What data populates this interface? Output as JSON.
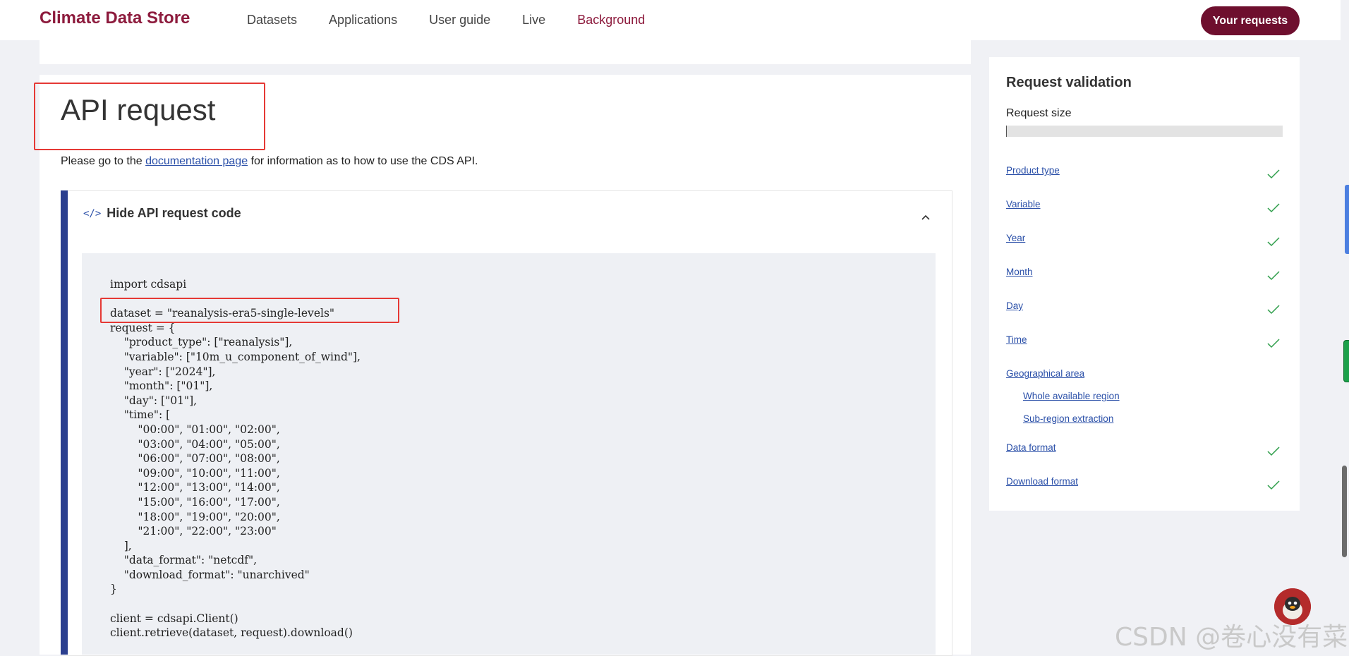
{
  "header": {
    "brand": "Climate Data Store",
    "nav": [
      "Datasets",
      "Applications",
      "User guide",
      "Live",
      "Background"
    ],
    "active_nav": "Background",
    "your_requests": "Your requests"
  },
  "main": {
    "title": "API request",
    "intro_before": "Please go to the ",
    "intro_link": "documentation page",
    "intro_after": " for information as to how to use the CDS API.",
    "toggle_icon": "</>",
    "toggle_label": "Hide API request code",
    "code": "import cdsapi\n\ndataset = \"reanalysis-era5-single-levels\"\nrequest = {\n    \"product_type\": [\"reanalysis\"],\n    \"variable\": [\"10m_u_component_of_wind\"],\n    \"year\": [\"2024\"],\n    \"month\": [\"01\"],\n    \"day\": [\"01\"],\n    \"time\": [\n        \"00:00\", \"01:00\", \"02:00\",\n        \"03:00\", \"04:00\", \"05:00\",\n        \"06:00\", \"07:00\", \"08:00\",\n        \"09:00\", \"10:00\", \"11:00\",\n        \"12:00\", \"13:00\", \"14:00\",\n        \"15:00\", \"16:00\", \"17:00\",\n        \"18:00\", \"19:00\", \"20:00\",\n        \"21:00\", \"22:00\", \"23:00\"\n    ],\n    \"data_format\": \"netcdf\",\n    \"download_format\": \"unarchived\"\n}\n\nclient = cdsapi.Client()\nclient.retrieve(dataset, request).download()"
  },
  "validation": {
    "title": "Request validation",
    "request_size_label": "Request size",
    "request_size_fraction": 0.0,
    "items": [
      {
        "label": "Product type",
        "check": true
      },
      {
        "label": "Variable",
        "check": true
      },
      {
        "label": "Year",
        "check": true
      },
      {
        "label": "Month",
        "check": true
      },
      {
        "label": "Day",
        "check": true
      },
      {
        "label": "Time",
        "check": true
      },
      {
        "label": "Geographical area",
        "check": false
      },
      {
        "label": "Whole available region",
        "check": false,
        "sub": true
      },
      {
        "label": "Sub-region extraction",
        "check": false,
        "sub": true
      },
      {
        "label": "Data format",
        "check": true
      },
      {
        "label": "Download format",
        "check": true
      }
    ]
  },
  "watermark": "CSDN @卷心没有菜",
  "colors": {
    "brand": "#8d1b3d",
    "button": "#6e0f2e",
    "link": "#2a4fa8",
    "check": "#2e9e4a",
    "highlight": "#e53935",
    "code_bar": "#2b3f8f"
  }
}
